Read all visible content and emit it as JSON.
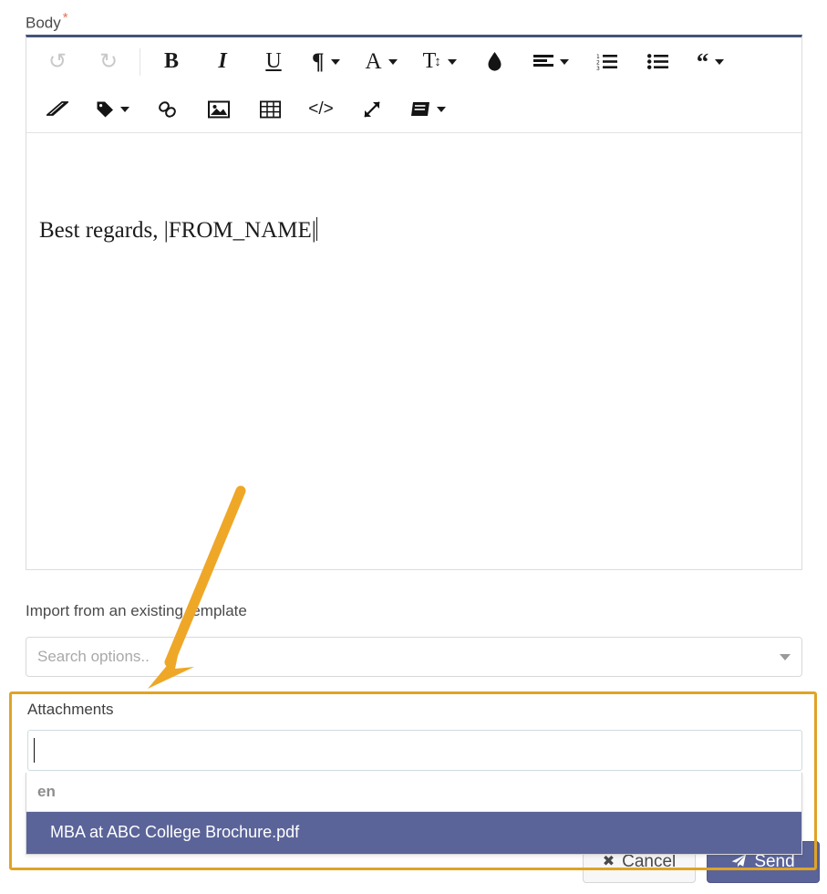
{
  "form": {
    "body_label": "Body",
    "required_marker": "*"
  },
  "editor": {
    "toolbar_row1": [
      {
        "name": "undo-icon",
        "glyph": "↺",
        "label": "Undo",
        "disabled": true,
        "caret": false
      },
      {
        "name": "redo-icon",
        "glyph": "↻",
        "label": "Redo",
        "disabled": true,
        "caret": false
      },
      {
        "name": "bold-icon",
        "glyph": "B",
        "label": "Bold",
        "disabled": false,
        "caret": false
      },
      {
        "name": "italic-icon",
        "glyph": "I",
        "label": "Italic",
        "disabled": false,
        "caret": false
      },
      {
        "name": "underline-icon",
        "glyph": "U",
        "label": "Underline",
        "disabled": false,
        "caret": false
      },
      {
        "name": "paragraph-format-icon",
        "glyph": "¶",
        "label": "Paragraph Format",
        "disabled": false,
        "caret": true
      },
      {
        "name": "font-family-icon",
        "glyph": "A",
        "label": "Font Family",
        "disabled": false,
        "caret": true
      },
      {
        "name": "font-size-icon",
        "glyph": "T↕",
        "label": "Font Size",
        "disabled": false,
        "caret": true
      },
      {
        "name": "text-color-icon",
        "glyph": "◆",
        "label": "Colors",
        "disabled": false,
        "caret": false
      },
      {
        "name": "align-icon",
        "glyph": "≡",
        "label": "Align",
        "disabled": false,
        "caret": true
      },
      {
        "name": "ordered-list-icon",
        "glyph": "1≡",
        "label": "Ordered List",
        "disabled": false,
        "caret": false
      },
      {
        "name": "unordered-list-icon",
        "glyph": "•≡",
        "label": "Unordered List",
        "disabled": false,
        "caret": false
      },
      {
        "name": "quote-icon",
        "glyph": "❝",
        "label": "Quote",
        "disabled": false,
        "caret": true
      }
    ],
    "toolbar_row2": [
      {
        "name": "clear-formatting-icon",
        "glyph": "▱",
        "label": "Clear Formatting",
        "caret": false
      },
      {
        "name": "tag-icon",
        "glyph": "🏷",
        "label": "Insert Tag",
        "caret": true
      },
      {
        "name": "link-icon",
        "glyph": "🔗",
        "label": "Insert Link",
        "caret": false
      },
      {
        "name": "image-icon",
        "glyph": "🖻",
        "label": "Insert Image",
        "caret": false
      },
      {
        "name": "table-icon",
        "glyph": "▦",
        "label": "Insert Table",
        "caret": false
      },
      {
        "name": "code-view-icon",
        "glyph": "</>",
        "label": "Code View",
        "caret": false
      },
      {
        "name": "fullscreen-icon",
        "glyph": "⤢",
        "label": "Fullscreen",
        "caret": false
      },
      {
        "name": "snippets-icon",
        "glyph": "▤",
        "label": "Snippets",
        "caret": true
      }
    ],
    "content": "Best regards, |FROM_NAME|"
  },
  "template_import": {
    "label": "Import from an existing template",
    "placeholder": "Search options.."
  },
  "attachments": {
    "label": "Attachments",
    "input_value": "",
    "group_header": "en",
    "options": [
      {
        "label": "MBA at ABC College Brochure.pdf",
        "selected": true
      }
    ]
  },
  "footer": {
    "cancel_label": "Cancel",
    "send_label": "Send"
  },
  "annotation": {
    "highlight_color": "#e0a326",
    "arrow_color": "#efa727"
  }
}
